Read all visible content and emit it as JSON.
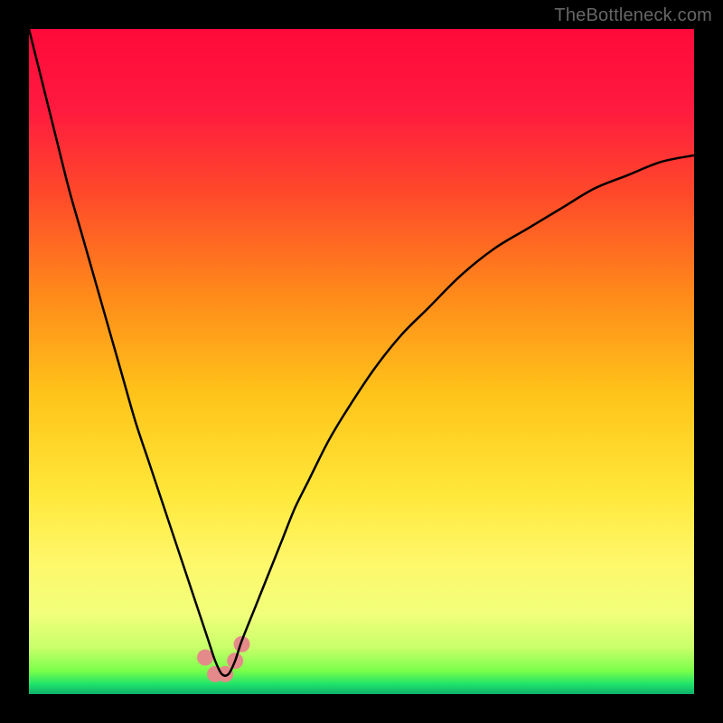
{
  "watermark": "TheBottleneck.com",
  "chart_data": {
    "type": "line",
    "title": "",
    "xlabel": "",
    "ylabel": "",
    "x_range": [
      0,
      100
    ],
    "y_range": [
      0,
      100
    ],
    "gradient_stops": [
      {
        "offset": 0.0,
        "color": "#ff0a3a"
      },
      {
        "offset": 0.12,
        "color": "#ff1a3f"
      },
      {
        "offset": 0.25,
        "color": "#ff4a2a"
      },
      {
        "offset": 0.4,
        "color": "#ff8a1a"
      },
      {
        "offset": 0.55,
        "color": "#ffc41a"
      },
      {
        "offset": 0.7,
        "color": "#ffe83a"
      },
      {
        "offset": 0.8,
        "color": "#fff76a"
      },
      {
        "offset": 0.88,
        "color": "#f1ff7a"
      },
      {
        "offset": 0.93,
        "color": "#c9ff6a"
      },
      {
        "offset": 0.965,
        "color": "#7aff4a"
      },
      {
        "offset": 0.985,
        "color": "#1fe36a"
      },
      {
        "offset": 1.0,
        "color": "#0db16a"
      }
    ],
    "series": [
      {
        "name": "bottleneck-curve",
        "color": "#000000",
        "stroke_width": 2.5,
        "minimum_x": 29,
        "x": [
          0,
          2,
          4,
          6,
          8,
          10,
          12,
          14,
          16,
          18,
          20,
          22,
          24,
          25,
          26,
          27,
          28,
          29,
          30,
          31,
          32,
          34,
          36,
          38,
          40,
          42,
          45,
          48,
          52,
          56,
          60,
          65,
          70,
          75,
          80,
          85,
          90,
          95,
          100
        ],
        "y": [
          100,
          92,
          84,
          76,
          69,
          62,
          55,
          48,
          41,
          35,
          29,
          23,
          17,
          14,
          11,
          8,
          5,
          3,
          3,
          5,
          8,
          13,
          18,
          23,
          28,
          32,
          38,
          43,
          49,
          54,
          58,
          63,
          67,
          70,
          73,
          76,
          78,
          80,
          81
        ]
      }
    ],
    "markers": [
      {
        "x": 26.5,
        "y": 5.5,
        "color": "#e58a8a",
        "r": 9
      },
      {
        "x": 28.0,
        "y": 3.0,
        "color": "#e58a8a",
        "r": 9
      },
      {
        "x": 29.5,
        "y": 3.0,
        "color": "#e58a8a",
        "r": 9
      },
      {
        "x": 31.0,
        "y": 5.0,
        "color": "#e58a8a",
        "r": 9
      },
      {
        "x": 32.0,
        "y": 7.5,
        "color": "#e58a8a",
        "r": 9
      }
    ]
  }
}
